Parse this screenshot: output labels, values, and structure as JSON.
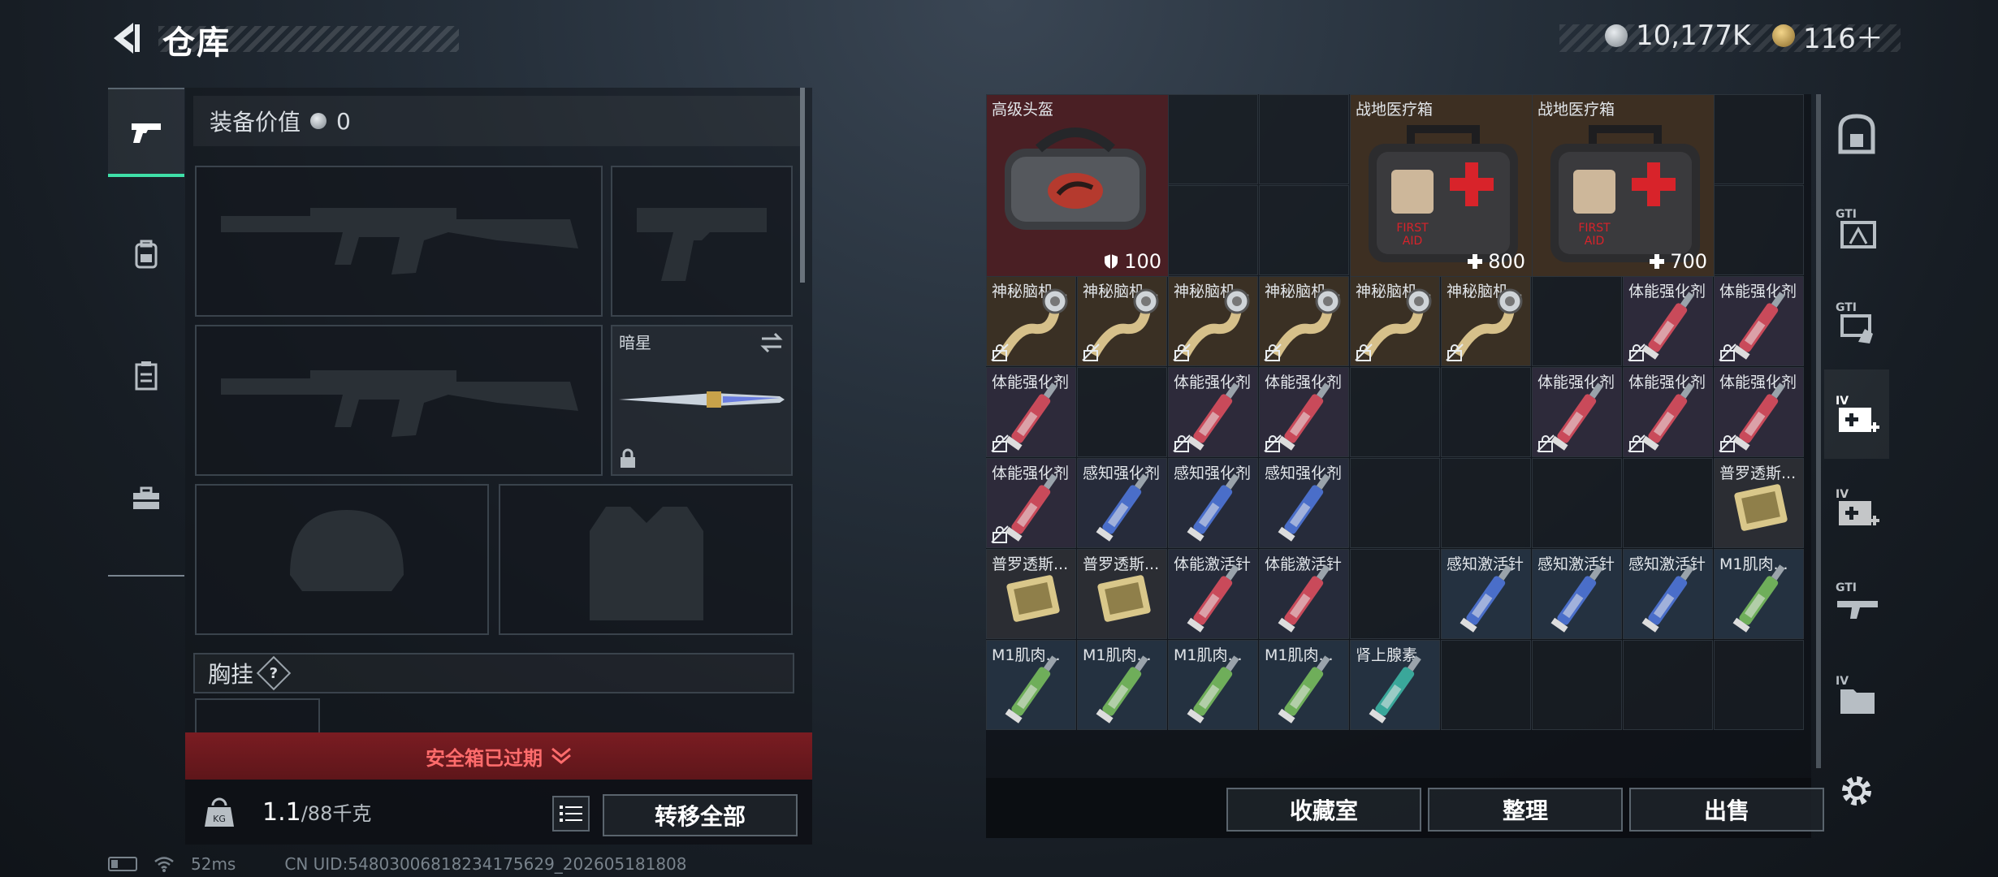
{
  "header": {
    "title": "仓库",
    "currency_silver": "10,177K",
    "currency_gold": "116＋"
  },
  "left_tabs": [
    {
      "name": "weapons",
      "icon": "pistol-icon",
      "active": true
    },
    {
      "name": "backpack",
      "icon": "backpack-icon",
      "active": false
    },
    {
      "name": "clipboard",
      "icon": "clipboard-icon",
      "active": false
    },
    {
      "name": "toolbox",
      "icon": "toolbox-icon",
      "active": false
    }
  ],
  "equipment": {
    "value_label": "装备价值",
    "value": "0",
    "melee_name": "暗星",
    "chest_rig_label": "胸挂",
    "chest_rig_help": "?",
    "safe_box_text": "安全箱已过期",
    "weight_value": "1.1",
    "weight_capacity": "/88千克",
    "transfer_all": "转移全部"
  },
  "grid": {
    "large_items": [
      {
        "label": "高级头盔",
        "stat_icon": "shield-icon",
        "value": "100",
        "bg": "#4a1f24",
        "icon": "duffel-bag-icon"
      },
      {
        "label": "战地医疗箱",
        "stat_icon": "plus-icon",
        "value": "800",
        "bg": "#3d2f22",
        "icon": "first-aid-kit-icon"
      },
      {
        "label": "战地医疗箱",
        "stat_icon": "plus-icon",
        "value": "700",
        "bg": "#3d2f22",
        "icon": "first-aid-kit-icon"
      }
    ],
    "rows": [
      [
        "神秘脑机...",
        "神秘脑机...",
        "神秘脑机...",
        "神秘脑机...",
        "神秘脑机...",
        "神秘脑机...",
        "",
        "体能强化剂",
        "体能强化剂"
      ],
      [
        "体能强化剂",
        "",
        "体能强化剂",
        "体能强化剂",
        "",
        "",
        "体能强化剂",
        "体能强化剂",
        "体能强化剂"
      ],
      [
        "体能强化剂",
        "感知强化剂",
        "感知强化剂",
        "感知强化剂",
        "",
        "",
        "",
        "",
        "普罗透斯..."
      ],
      [
        "普罗透斯...",
        "普罗透斯...",
        "体能激活针",
        "体能激活针",
        "",
        "感知激活针",
        "感知激活针",
        "感知激活针",
        "M1肌肉..."
      ],
      [
        "M1肌肉...",
        "M1肌肉...",
        "M1肌肉...",
        "M1肌肉...",
        "肾上腺素",
        "",
        "",
        "",
        ""
      ]
    ]
  },
  "grid_buttons": {
    "collection": "收藏室",
    "sort": "整理",
    "sell": "出售"
  },
  "right_tabs": [
    "vault-icon",
    "gti-case-icon",
    "gti-hand-icon",
    "iv-medkit-icon",
    "iv-medkit-icon",
    "gti-gun-icon",
    "iv-folder-icon"
  ],
  "status": {
    "ping": "52ms",
    "uid": "CN UID:548030068182341756​29_20260518​1808"
  },
  "colors": {
    "accent_green": "#3fe0a8",
    "expired_red": "#ff6c6c",
    "brain_bg": "#3a3024",
    "red_syringe_bg": "#2d2a3a",
    "blue_syringe_bg": "#262b3a",
    "chip_bg": "#2b2d33",
    "green_syringe_bg": "#243140"
  }
}
